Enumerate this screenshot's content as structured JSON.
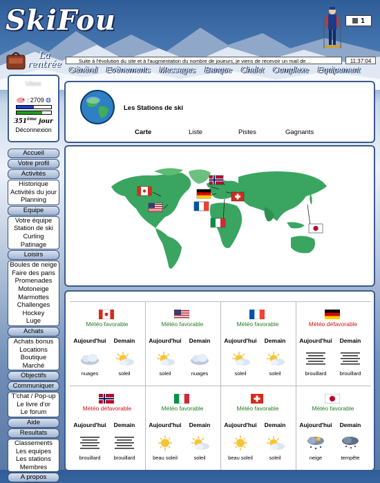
{
  "header": {
    "logo": "SkiFou",
    "counter": "1",
    "rentree": [
      "La",
      "rentrée"
    ],
    "ticker": "Suite à l'évolution du site et à l'augmentation du nombre de joueurs, je viens de recevoir un mail de…",
    "clock": "11:37:04"
  },
  "topnav": [
    "Général",
    "Evénements",
    "Messages",
    "Banque",
    "Chalet",
    "Complexe",
    "Equipement"
  ],
  "profile": {
    "username": "Ulxxx",
    "points": "2709",
    "bar1_pct": 50,
    "bar2_pct": 75,
    "rank_num": "351",
    "rank_sup": "ème",
    "rank_word": "jour",
    "logout": "Déconnexion"
  },
  "sidebar": {
    "accueil": "Accueil",
    "votre_profil": "Votre profil",
    "activites": {
      "title": "Activités",
      "items": [
        "Historique",
        "Activités du jour",
        "Planning"
      ]
    },
    "equipe": {
      "title": "Equipe",
      "items": [
        "Votre équipe",
        "Station de ski",
        "Curling",
        "Patinage"
      ]
    },
    "loisirs": {
      "title": "Loisirs",
      "items": [
        "Boules de neige",
        "Faire des paris",
        "Promenades",
        "Motoneige",
        "Marmottes",
        "Challenges",
        "Hockey",
        "Luge"
      ]
    },
    "achats": {
      "title": "Achats",
      "items": [
        "Achats bonus",
        "Locations",
        "Boutique",
        "Marché"
      ]
    },
    "objectifs": "Objectifs",
    "communiquer": {
      "title": "Communiquer",
      "items": [
        "T'chat / Pop-up",
        "Le livre d'or",
        "Le forum"
      ]
    },
    "aide": "Aide",
    "resultats": {
      "title": "Resultats",
      "items": [
        "Classements",
        "Les equipes",
        "Les stations",
        "Membres"
      ]
    },
    "apropos": "A propos"
  },
  "stations": {
    "title": "Les Stations de ski",
    "tabs": [
      "Carte",
      "Liste",
      "Pistes",
      "Gagnants"
    ]
  },
  "weather": {
    "today": "Aujourd'hui",
    "tomorrow": "Demain",
    "cells": [
      {
        "country": "canada",
        "status": "Météo favorable",
        "good": true,
        "today": "nuages",
        "tomorrow": "soleil",
        "today_icon": "cloud-icon",
        "tomorrow_icon": "partly-sunny-icon"
      },
      {
        "country": "usa",
        "status": "Météo favorable",
        "good": true,
        "today": "soleil",
        "tomorrow": "nuages",
        "today_icon": "partly-sunny-icon",
        "tomorrow_icon": "cloud-icon"
      },
      {
        "country": "france",
        "status": "Météo favorable",
        "good": true,
        "today": "soleil",
        "tomorrow": "soleil",
        "today_icon": "partly-sunny-icon",
        "tomorrow_icon": "partly-sunny-icon"
      },
      {
        "country": "germany",
        "status": "Météo défavorable",
        "good": false,
        "today": "brouillard",
        "tomorrow": "brouillard",
        "today_icon": "fog-icon",
        "tomorrow_icon": "fog-icon"
      },
      {
        "country": "norway",
        "status": "Météo défavorable",
        "good": false,
        "today": "brouillard",
        "tomorrow": "brouillard",
        "today_icon": "fog-icon",
        "tomorrow_icon": "fog-icon"
      },
      {
        "country": "italy",
        "status": "Météo favorable",
        "good": true,
        "today": "beau soleil",
        "tomorrow": "soleil",
        "today_icon": "sun-icon",
        "tomorrow_icon": "partly-sunny-icon"
      },
      {
        "country": "switzerland",
        "status": "Météo favorable",
        "good": true,
        "today": "beau soleil",
        "tomorrow": "soleil",
        "today_icon": "sun-icon",
        "tomorrow_icon": "partly-sunny-icon"
      },
      {
        "country": "japan",
        "status": "Météo favorable",
        "good": true,
        "today": "neige",
        "tomorrow": "tempête",
        "today_icon": "snow-icon",
        "tomorrow_icon": "storm-icon"
      }
    ]
  },
  "colors": {
    "nav_border": "#3a5a8e",
    "good": "#1e7d1e",
    "bad": "#d01010",
    "map_green": "#3aa560"
  }
}
